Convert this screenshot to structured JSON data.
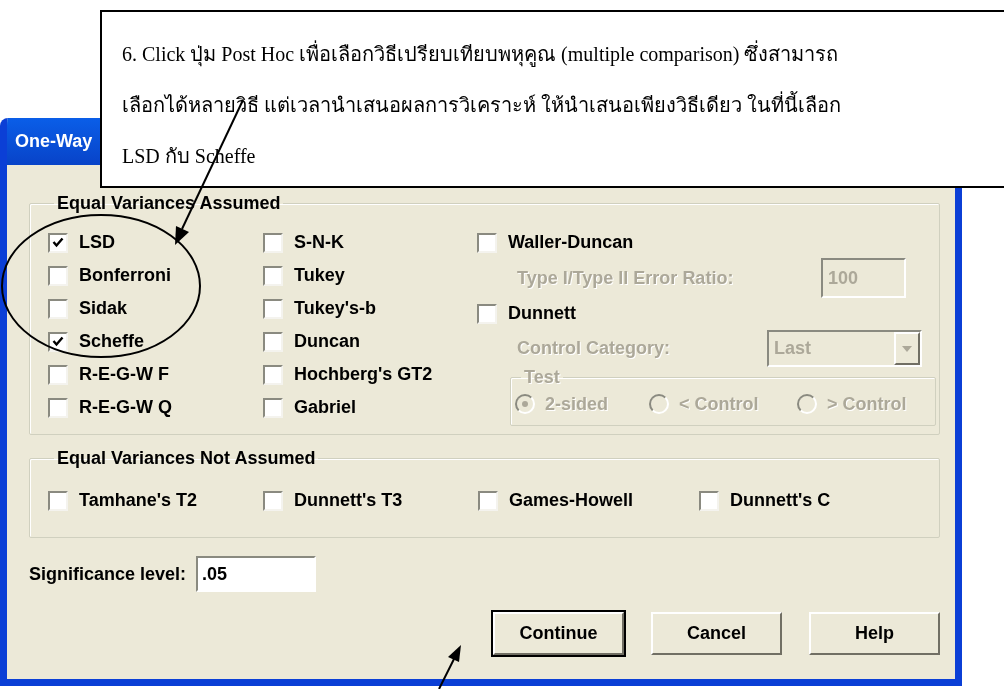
{
  "callout": {
    "lines": [
      "6. Click ปุ่ม Post Hoc เพื่อเลือกวิธีเปรียบเทียบพหุคูณ (multiple comparison) ซึ่งสามารถ",
      "เลือกได้หลายวิธี แต่เวลานำเสนอผลการวิเคราะห์ ให้นำเสนอเพียงวิธีเดียว ในที่นี้เลือก",
      "LSD กับ Scheffe"
    ]
  },
  "window": {
    "title": "One-Way"
  },
  "equal_variances_assumed": {
    "title": "Equal Variances Assumed",
    "columns": [
      [
        {
          "label": "LSD",
          "checked": true
        },
        {
          "label": "Bonferroni",
          "checked": false
        },
        {
          "label": "Sidak",
          "checked": false
        },
        {
          "label": "Scheffe",
          "checked": true
        },
        {
          "label": "R-E-G-W F",
          "checked": false
        },
        {
          "label": "R-E-G-W Q",
          "checked": false
        }
      ],
      [
        {
          "label": "S-N-K",
          "checked": false
        },
        {
          "label": "Tukey",
          "checked": false
        },
        {
          "label": "Tukey's-b",
          "checked": false
        },
        {
          "label": "Duncan",
          "checked": false
        },
        {
          "label": "Hochberg's GT2",
          "checked": false
        },
        {
          "label": "Gabriel",
          "checked": false
        }
      ]
    ],
    "waller_duncan": {
      "label": "Waller-Duncan",
      "checked": false
    },
    "error_ratio": {
      "label": "Type I/Type II Error Ratio:",
      "value": "100",
      "disabled": true
    },
    "dunnett": {
      "label": "Dunnett",
      "checked": false
    },
    "control_category": {
      "label": "Control Category:",
      "value": "Last",
      "disabled": true
    },
    "test": {
      "title": "Test",
      "disabled": true,
      "options": [
        {
          "label": "2-sided",
          "selected": true
        },
        {
          "label": "< Control",
          "selected": false
        },
        {
          "label": "> Control",
          "selected": false
        }
      ]
    }
  },
  "equal_variances_not_assumed": {
    "title": "Equal Variances Not Assumed",
    "items": [
      {
        "label": "Tamhane's T2",
        "checked": false
      },
      {
        "label": "Dunnett's T3",
        "checked": false
      },
      {
        "label": "Games-Howell",
        "checked": false
      },
      {
        "label": "Dunnett's C",
        "checked": false
      }
    ]
  },
  "significance": {
    "label": "Significance level:",
    "value": ".05"
  },
  "buttons": [
    {
      "label": "Continue",
      "default": true
    },
    {
      "label": "Cancel",
      "default": false
    },
    {
      "label": "Help",
      "default": false
    }
  ]
}
